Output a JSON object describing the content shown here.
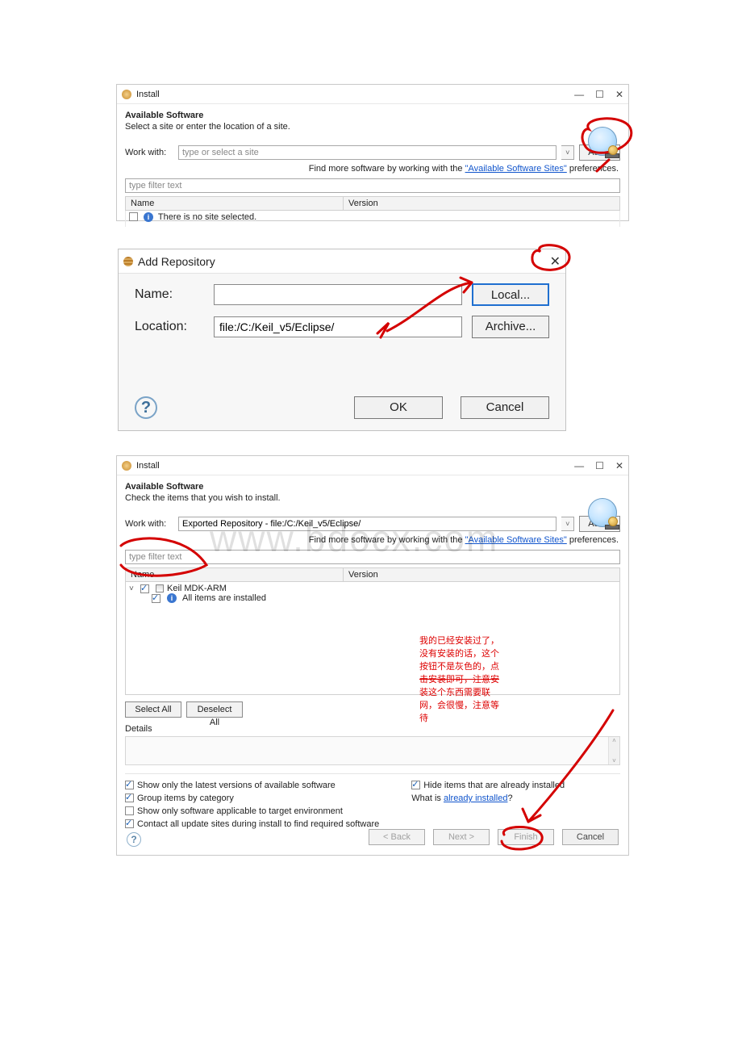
{
  "colors": {
    "accent_blue": "#1f6fd0",
    "annotation_red": "#d40000",
    "link_blue": "#1155cc"
  },
  "dlg1": {
    "title": "Install",
    "win_min": "—",
    "win_max": "☐",
    "win_close": "✕",
    "heading": "Available Software",
    "sub": "Select a site or enter the location of a site.",
    "work_with_label": "Work with:",
    "work_with_value": "type or select a site",
    "add_btn": "Add...",
    "find_prefix": "Find more software by working with the ",
    "find_link": "\"Available Software Sites\"",
    "find_suffix": " preferences.",
    "filter_placeholder": "type filter text",
    "col_name": "Name",
    "col_version": "Version",
    "row_msg": "There is no site selected."
  },
  "addrepo": {
    "title": "Add Repository",
    "close": "✕",
    "name_label": "Name:",
    "name_value": "",
    "local_btn": "Local...",
    "loc_label": "Location:",
    "loc_value": "file:/C:/Keil_v5/Eclipse/",
    "archive_btn": "Archive...",
    "help": "?",
    "ok": "OK",
    "cancel": "Cancel"
  },
  "dlg2": {
    "title": "Install",
    "win_min": "—",
    "win_max": "☐",
    "win_close": "✕",
    "heading": "Available Software",
    "sub": "Check the items that you wish to install.",
    "work_with_label": "Work with:",
    "work_with_value": "Exported Repository - file:/C:/Keil_v5/Eclipse/",
    "add_btn": "Add...",
    "find_prefix": "Find more software by working with the ",
    "find_link": "\"Available Software Sites\"",
    "find_suffix": " preferences.",
    "filter_placeholder": "type filter text",
    "col_name": "Name",
    "col_version": "Version",
    "tree_parent": "Keil MDK-ARM",
    "tree_child": "All items are installed",
    "select_all": "Select All",
    "deselect_all": "Deselect All",
    "details": "Details",
    "opt_latest": "Show only the latest versions of available software",
    "opt_group": "Group items by category",
    "opt_target": "Show only software applicable to target environment",
    "opt_contact": "Contact all update sites during install to find required software",
    "opt_hide": "Hide items that are already installed",
    "already_prefix": "What is ",
    "already_link": "already installed",
    "already_suffix": "?",
    "help": "?",
    "back": "< Back",
    "next": "Next >",
    "finish": "Finish",
    "cancel": "Cancel"
  },
  "notes": {
    "line1": "我的已经安装过了，",
    "line2": "没有安装的话，这个",
    "line3": "按钮不是灰色的，点",
    "line4": "击安装即可，注意安",
    "line5": "装这个东西需要联",
    "line6": "网，会很慢，注意等",
    "line7": "待"
  },
  "watermark": "www.bdocx.com"
}
